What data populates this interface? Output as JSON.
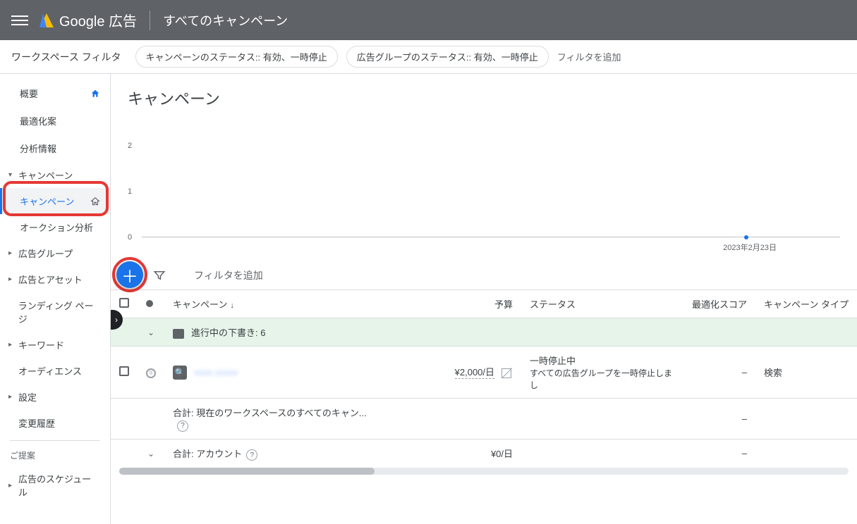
{
  "header": {
    "brand": "Google 広告",
    "title": "すべてのキャンペーン"
  },
  "filters": {
    "label": "ワークスペース フィルタ",
    "chips": [
      "キャンペーンのステータス:: 有効、一時停止",
      "広告グループのステータス:: 有効、一時停止"
    ],
    "add": "フィルタを追加"
  },
  "sidebar": {
    "overview": "概要",
    "optimize": "最適化案",
    "insights": "分析情報",
    "campaigns_group": "キャンペーン",
    "campaigns": "キャンペーン",
    "auction": "オークション分析",
    "adgroups": "広告グループ",
    "ads_assets": "広告とアセット",
    "landing": "ランディング ページ",
    "keywords": "キーワード",
    "audience": "オーディエンス",
    "settings": "設定",
    "history": "変更履歴",
    "suggest_label": "ご提案",
    "ad_schedule": "広告のスケジュール"
  },
  "main": {
    "title": "キャンペーン",
    "filter_placeholder": "フィルタを追加"
  },
  "chart_data": {
    "type": "line",
    "y_ticks": [
      "2",
      "1",
      "0"
    ],
    "date_label": "2023年2月23日",
    "series": [
      {
        "name": "",
        "values": [
          0
        ]
      }
    ]
  },
  "table": {
    "headers": {
      "campaign": "キャンペーン",
      "budget": "予算",
      "status": "ステータス",
      "opt_score": "最適化スコア",
      "type": "キャンペーン タイプ"
    },
    "group_row": "進行中の下書き: 6",
    "row1": {
      "name": "xxxx xxxxx",
      "budget": "¥2,000/日",
      "status_line1": "一時停止中",
      "status_line2": "すべての広告グループを一時停止しまし",
      "opt": "–",
      "type": "検索"
    },
    "total1": {
      "label": "合計: 現在のワークスペースのすべてのキャン...",
      "opt": "–"
    },
    "total2": {
      "label": "合計: アカウント",
      "budget": "¥0/日",
      "opt": "–"
    }
  }
}
